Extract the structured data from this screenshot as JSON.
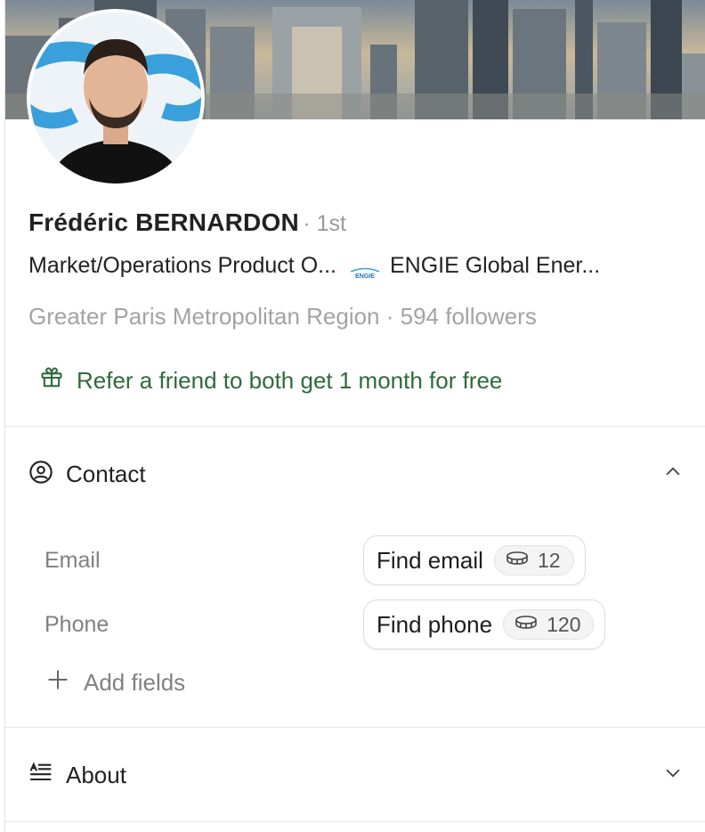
{
  "profile": {
    "name": "Frédéric BERNARDON",
    "degree": "· 1st",
    "headline": "Market/Operations Product O...",
    "company_logo_text": "ENGIE",
    "company": "ENGIE Global Ener...",
    "location_line": "Greater Paris Metropolitan Region · 594 followers"
  },
  "referral": {
    "label": "Refer a friend to both get 1 month for free"
  },
  "contact": {
    "title": "Contact",
    "email_label": "Email",
    "find_email_label": "Find email",
    "email_credits": "12",
    "phone_label": "Phone",
    "find_phone_label": "Find phone",
    "phone_credits": "120",
    "add_fields_label": "Add fields"
  },
  "about": {
    "title": "About"
  },
  "colors": {
    "accent_green": "#2f6a3c",
    "muted_text": "#a3a3a3",
    "divider": "#e6e6e6"
  },
  "icons": [
    "gift-icon",
    "user-circle-icon",
    "chevron-up-icon",
    "coin-icon",
    "plus-icon",
    "about-lines-icon",
    "chevron-down-icon"
  ]
}
